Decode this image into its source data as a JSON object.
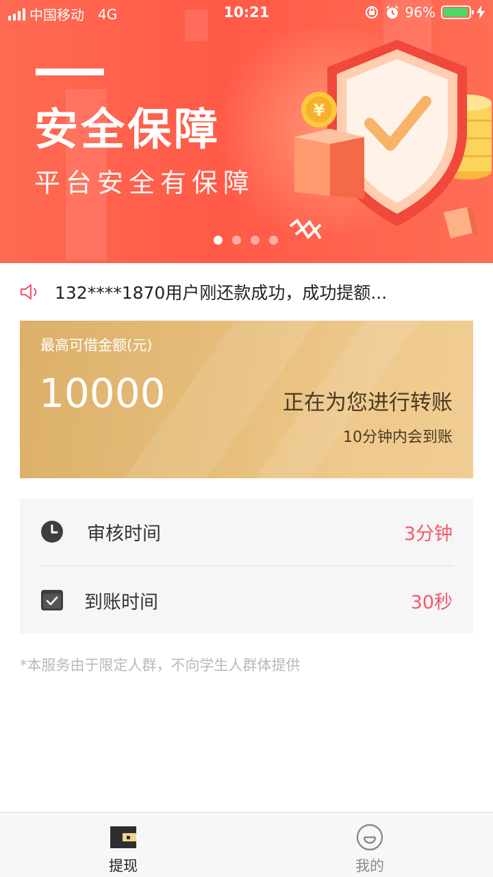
{
  "status_bar": {
    "carrier": "中国移动",
    "network": "4G",
    "time": "10:21",
    "battery": "96%",
    "battery_level": 0.96
  },
  "banner": {
    "title": "安全保障",
    "subtitle": "平台安全有保障",
    "coin_symbol": "¥",
    "slide_count": 4,
    "active_slide": 1
  },
  "notice": {
    "text": "132****1870用户刚还款成功，成功提额..."
  },
  "loan_card": {
    "label": "最高可借金额(元)",
    "amount": "10000",
    "status": "正在为您进行转账",
    "note": "10分钟内会到账"
  },
  "time_info": {
    "review_label": "审核时间",
    "review_value": "3分钟",
    "arrival_label": "到账时间",
    "arrival_value": "30秒"
  },
  "disclaimer": "*本服务由于限定人群，不向学生人群体提供",
  "bottom_nav": {
    "items": [
      {
        "label": "提现",
        "icon": "wallet-icon",
        "active": true
      },
      {
        "label": "我的",
        "icon": "profile-icon",
        "active": false
      }
    ]
  },
  "colors": {
    "banner_red": "#ff5a48",
    "card_gold": "#e6bd7a",
    "value_red": "#f4596a",
    "battery_green": "#4cd964"
  }
}
